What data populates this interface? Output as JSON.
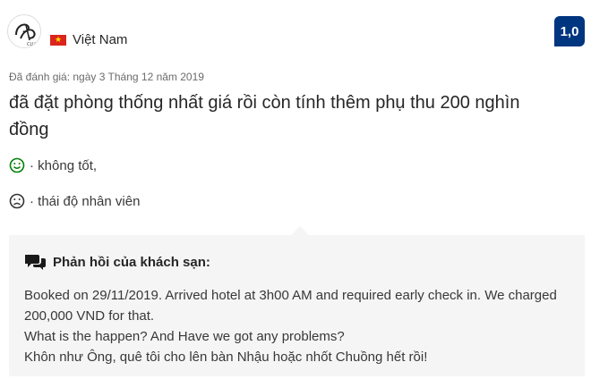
{
  "reviewer": {
    "avatar_icon": "reviewer-avatar-logo",
    "country": "Việt Nam",
    "flag_icon": "vietnam-flag-icon"
  },
  "score": "1,0",
  "review": {
    "date": "Đã đánh giá: ngày 3 Tháng 12 năm 2019",
    "title": "đã đặt phòng thống nhất giá rồi còn tính thêm phụ thu 200 nghìn đồng",
    "positive": "· không tốt,",
    "negative": "· thái độ nhân viên"
  },
  "hotel_reply": {
    "heading": "Phản hồi của khách sạn:",
    "lines": [
      "Booked on 29/11/2019. Arrived hotel at 3h00 AM and required early check in. We charged 200,000 VND for that.",
      "What is the happen? And Have we got any problems?",
      "Khôn như Ông, quê tôi cho lên bàn Nhậu hoặc nhốt Chuồng hết rồi!"
    ]
  },
  "colors": {
    "score_bg": "#003580",
    "positive_icon": "#008009",
    "negative_icon": "#333333",
    "reply_bg": "#f5f5f5"
  }
}
